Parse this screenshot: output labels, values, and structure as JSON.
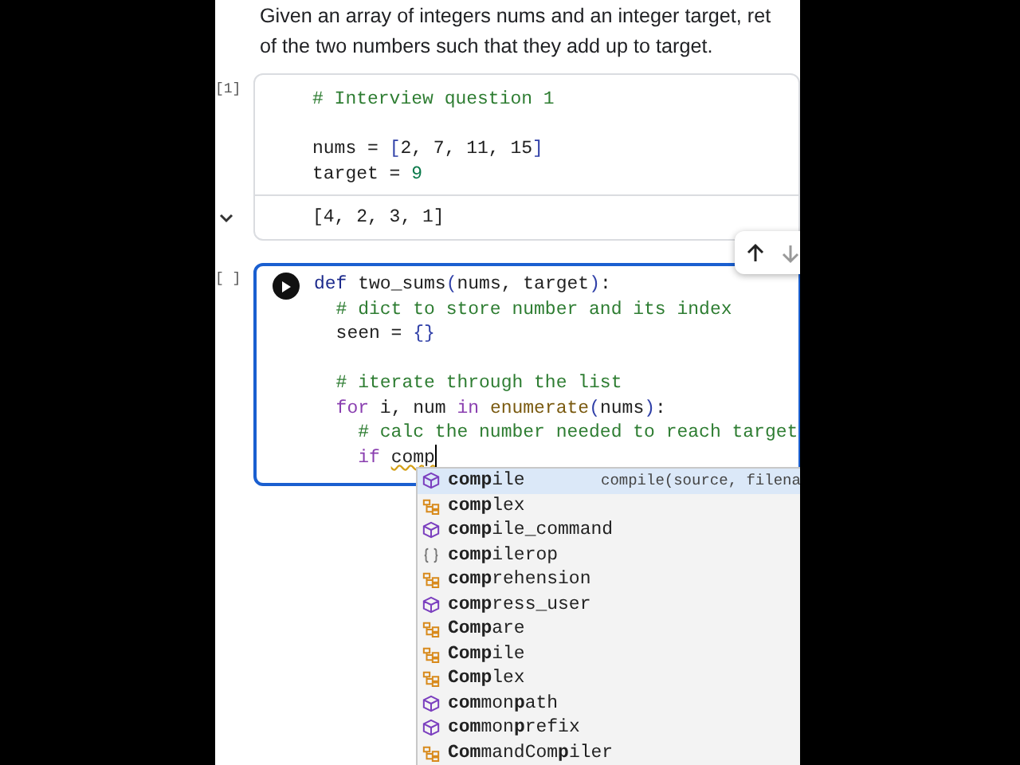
{
  "description": [
    "Given an array of integers nums and an integer target, ret",
    "of the two numbers such that they add up to target."
  ],
  "cells": [
    {
      "count": "[1]",
      "running": false,
      "editing": false,
      "lines": [
        {
          "kind": "code",
          "tokens": [
            {
              "t": "# Interview question 1",
              "kind": "comment"
            }
          ]
        },
        {
          "kind": "blank"
        },
        {
          "kind": "code",
          "tokens": [
            {
              "t": "nums = ",
              "kind": "plain"
            },
            {
              "t": "[",
              "kind": "bracket"
            },
            {
              "t": "2, 7, 11, 15",
              "kind": "plain"
            },
            {
              "t": "]",
              "kind": "bracket"
            }
          ]
        },
        {
          "kind": "code",
          "tokens": [
            {
              "t": "target = ",
              "kind": "plain"
            },
            {
              "t": "9",
              "kind": "number"
            }
          ]
        }
      ],
      "output": "[4, 2, 3, 1]"
    },
    {
      "count": "[ ]",
      "running": true,
      "editing": true,
      "lines": [
        {
          "kind": "code",
          "tokens": [
            {
              "t": "def ",
              "kind": "def"
            },
            {
              "t": "two_sums",
              "kind": "plain"
            },
            {
              "t": "(",
              "kind": "bracket"
            },
            {
              "t": "nums, target",
              "kind": "plain"
            },
            {
              "t": ")",
              "kind": "bracket"
            },
            {
              "t": ":",
              "kind": "plain"
            }
          ]
        },
        {
          "kind": "code",
          "tokens": [
            {
              "t": "  # dict to store number and its index",
              "kind": "comment"
            }
          ]
        },
        {
          "kind": "code",
          "tokens": [
            {
              "t": "  seen = ",
              "kind": "plain"
            },
            {
              "t": "{}",
              "kind": "bracket"
            }
          ]
        },
        {
          "kind": "blank"
        },
        {
          "kind": "code",
          "tokens": [
            {
              "t": "  # iterate through the list",
              "kind": "comment"
            }
          ]
        },
        {
          "kind": "code",
          "tokens": [
            {
              "t": "  for ",
              "kind": "kw"
            },
            {
              "t": "i, num ",
              "kind": "plain"
            },
            {
              "t": "in ",
              "kind": "kw"
            },
            {
              "t": "enumerate",
              "kind": "func"
            },
            {
              "t": "(",
              "kind": "bracket"
            },
            {
              "t": "nums",
              "kind": "plain"
            },
            {
              "t": ")",
              "kind": "bracket"
            },
            {
              "t": ":",
              "kind": "plain"
            }
          ]
        },
        {
          "kind": "code",
          "tokens": [
            {
              "t": "    # calc the number needed to reach target",
              "kind": "comment"
            }
          ]
        },
        {
          "kind": "code",
          "tokens": [
            {
              "t": "    if ",
              "kind": "kw"
            },
            {
              "t": "comp",
              "kind": "plain",
              "squiggle": true,
              "cursor": true
            }
          ]
        }
      ]
    }
  ],
  "completions": [
    {
      "label": "**comp**ile",
      "kind": "method",
      "selected": true,
      "detail": "compile(source, filena"
    },
    {
      "label": "**comp**lex",
      "kind": "class",
      "selected": false
    },
    {
      "label": "**comp**ile_command",
      "kind": "method",
      "selected": false
    },
    {
      "label": "**comp**ilerop",
      "kind": "module",
      "selected": false
    },
    {
      "label": "**comp**rehension",
      "kind": "class",
      "selected": false
    },
    {
      "label": "**comp**ress_user",
      "kind": "method",
      "selected": false
    },
    {
      "label": "**Comp**are",
      "kind": "class",
      "selected": false
    },
    {
      "label": "**Comp**ile",
      "kind": "class",
      "selected": false
    },
    {
      "label": "**Comp**lex",
      "kind": "class",
      "selected": false
    },
    {
      "label": "**com**mon**p**ath",
      "kind": "method",
      "selected": false
    },
    {
      "label": "**com**mon**p**refix",
      "kind": "method",
      "selected": false
    },
    {
      "label": "**Com**mandCom**p**iler",
      "kind": "class",
      "selected": false
    }
  ]
}
